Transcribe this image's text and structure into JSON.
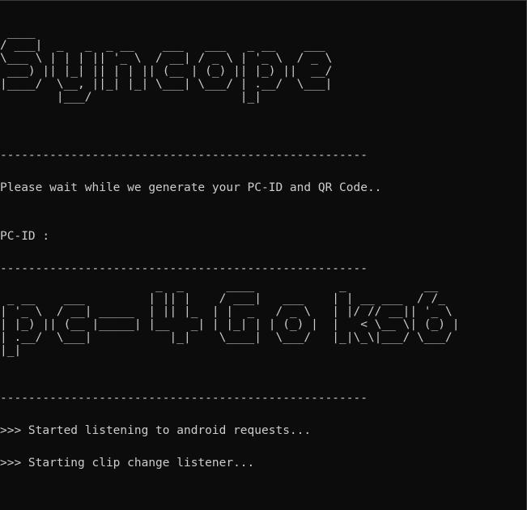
{
  "console": {
    "banner_title": " ____\n/ ___|  _   _  _ __    ___   ___   _ __    ___\n\\___ \\ | | | || '_ \\  / __| / _ \\ | '_ \\  / _ \\\n ___) || |_| || | | || (__ | (_) || |_) ||  __/\n|____/  \\__, ||_| |_| \\___| \\___/ | .__/  \\___|\n        |___/                     |_|",
    "separator_1": "----------------------------------------------------",
    "wait_message": "Please wait while we generate your PC-ID and QR Code..",
    "pc_id_label": "PC-ID :",
    "separator_2": "----------------------------------------------------",
    "banner_pc_id": "                      _  _      ____            _           __\n _ __    ___         | || |    / ___|   ___    | | __ ___  / /_\n| '_ \\  / __| _____  | || |_  | |  _   / _ \\   | |/ // __|| '_ \\\n| |_) || (__ |_____| |__   _| | |_| | | (_) |  |   < \\__ \\| (_) |\n| .__/  \\___|           |_|    \\____|  \\___/   |_|\\_\\|___/ \\___/\n|_|",
    "separator_3": "----------------------------------------------------",
    "status_1": ">>> Started listening to android requests...",
    "status_2": ">>> Starting clip change listener..."
  }
}
